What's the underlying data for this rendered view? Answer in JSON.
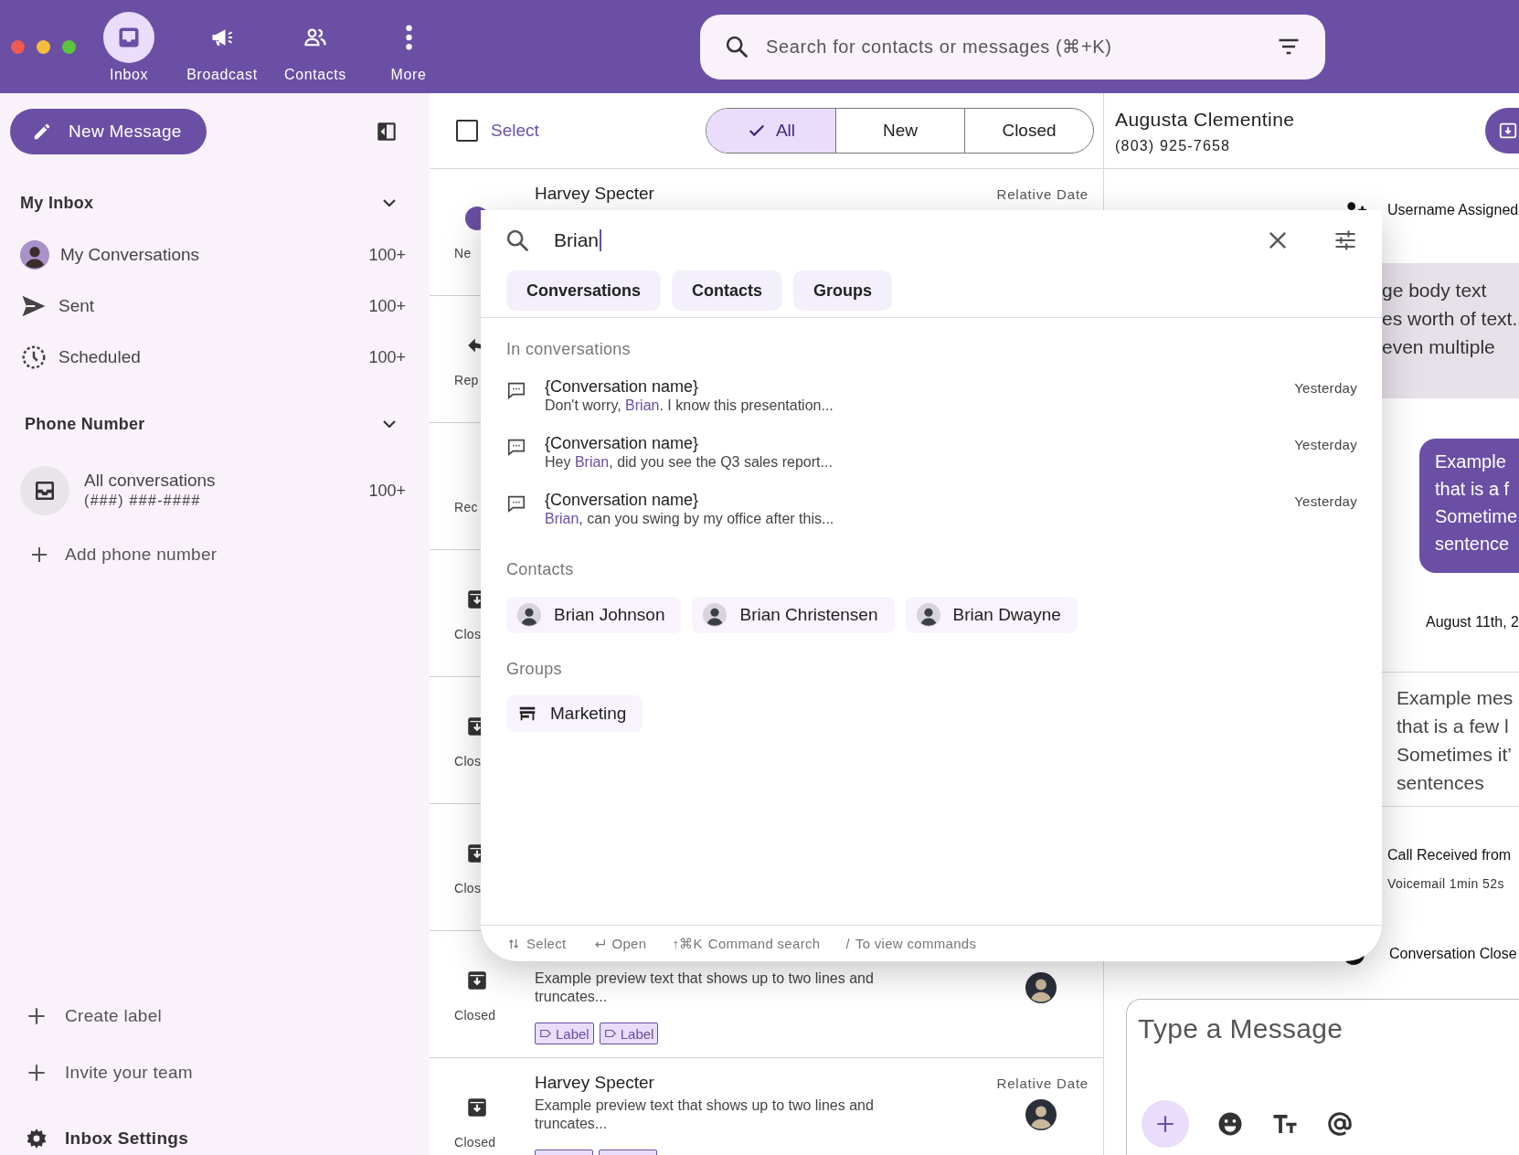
{
  "window": {
    "controls": [
      {
        "color": "#ee5b52"
      },
      {
        "color": "#f4bd3b"
      },
      {
        "color": "#5dc43e"
      }
    ]
  },
  "nav": [
    {
      "label": "Inbox",
      "selected": true
    },
    {
      "label": "Broadcast",
      "selected": false
    },
    {
      "label": "Contacts",
      "selected": false
    },
    {
      "label": "More",
      "selected": false
    }
  ],
  "search": {
    "placeholder": "Search for contacts or messages (⌘+K)"
  },
  "sidebar": {
    "new_message": "New Message",
    "sections": [
      {
        "title": "My Inbox",
        "expanded": true,
        "items": [
          {
            "label": "My Conversations",
            "count": "100+"
          },
          {
            "label": "Sent",
            "count": "100+"
          },
          {
            "label": "Scheduled",
            "count": "100+"
          }
        ]
      },
      {
        "title": "Phone Number",
        "expanded": true,
        "items": [
          {
            "label": "All conversations",
            "sublabel": "(###) ###-####",
            "count": "100+"
          }
        ],
        "add": "Add phone number"
      }
    ],
    "actions": [
      {
        "kind": "add",
        "label": "Create label"
      },
      {
        "kind": "add",
        "label": "Invite your team"
      },
      {
        "kind": "settings",
        "label": "Inbox Settings"
      }
    ]
  },
  "list": {
    "select_label": "Select",
    "select_checked": false,
    "filters": [
      {
        "label": "All",
        "selected": true
      },
      {
        "label": "New",
        "selected": false
      },
      {
        "label": "Closed",
        "selected": false
      }
    ],
    "rows": [
      {
        "kind": "new",
        "status": "Ne",
        "name": "Harvey Specter",
        "date": "Relative Date"
      },
      {
        "kind": "replied",
        "status": "Rep"
      },
      {
        "kind": "received",
        "status": "Rec"
      },
      {
        "kind": "closed",
        "status": "Clos"
      },
      {
        "kind": "closed",
        "status": "Clos"
      },
      {
        "kind": "closed",
        "status": "Clos"
      },
      {
        "kind": "closed",
        "status": "Closed",
        "preview": "Example preview text that shows up to two lines and truncates...",
        "labels": [
          "Label",
          "Label"
        ],
        "avatar": true
      },
      {
        "kind": "closed",
        "status": "Closed",
        "name": "Harvey Specter",
        "date": "Relative Date",
        "preview": "Example preview text that shows up to two lines and truncates...",
        "avatar": true,
        "labels_cut": true
      }
    ]
  },
  "conversation": {
    "name": "Augusta Clementine",
    "phone": "(803) 925-7658",
    "events": [
      {
        "kind": "assigned",
        "text": "Username Assigned"
      },
      {
        "kind": "incoming",
        "lines": [
          "ge body text",
          "es worth of text.",
          "even multiple"
        ]
      },
      {
        "kind": "outgoing",
        "lines": [
          "Example",
          "that is a f",
          "Sometime",
          "sentence"
        ]
      },
      {
        "kind": "date",
        "text": "August 11th, 2"
      },
      {
        "kind": "message",
        "lines": [
          "Example mes",
          "that is a few l",
          "Sometimes it’",
          "sentences"
        ]
      },
      {
        "kind": "call",
        "text": "Call Received from",
        "detail": "Voicemail 1min 52s"
      },
      {
        "kind": "closed",
        "text": "Conversation Close"
      }
    ],
    "composer": {
      "placeholder": "Type a Message"
    }
  },
  "popup": {
    "query": "Brian",
    "tabs": [
      {
        "label": "Conversations",
        "selected": false
      },
      {
        "label": "Contacts",
        "selected": false
      },
      {
        "label": "Groups",
        "selected": false
      }
    ],
    "conversations_heading": "In conversations",
    "results": [
      {
        "title": "{Conversation name}",
        "snippet": [
          {
            "text": "Don't worry, ",
            "match": false
          },
          {
            "text": "Brian",
            "match": true
          },
          {
            "text": ". I know this presentation...",
            "match": false
          }
        ],
        "date": "Yesterday"
      },
      {
        "title": "{Conversation name}",
        "snippet": [
          {
            "text": "Hey ",
            "match": false
          },
          {
            "text": "Brian",
            "match": true
          },
          {
            "text": ", did you see the Q3 sales report...",
            "match": false
          }
        ],
        "date": "Yesterday"
      },
      {
        "title": "{Conversation name}",
        "snippet": [
          {
            "text": "Brian",
            "match": true
          },
          {
            "text": ", can you swing by my office after this...",
            "match": false
          }
        ],
        "date": "Yesterday"
      }
    ],
    "contacts_heading": "Contacts",
    "contacts": [
      {
        "name": "Brian Johnson"
      },
      {
        "name": "Brian Christensen"
      },
      {
        "name": "Brian Dwayne"
      }
    ],
    "groups_heading": "Groups",
    "groups": [
      {
        "name": "Marketing"
      }
    ],
    "hints": [
      {
        "kind": "select",
        "label": "Select"
      },
      {
        "kind": "open",
        "label": "Open"
      },
      {
        "kind": "keys",
        "keys": "↑⌘K",
        "label": "Command search"
      },
      {
        "kind": "keys",
        "keys": "/",
        "label": "To view commands"
      }
    ]
  }
}
